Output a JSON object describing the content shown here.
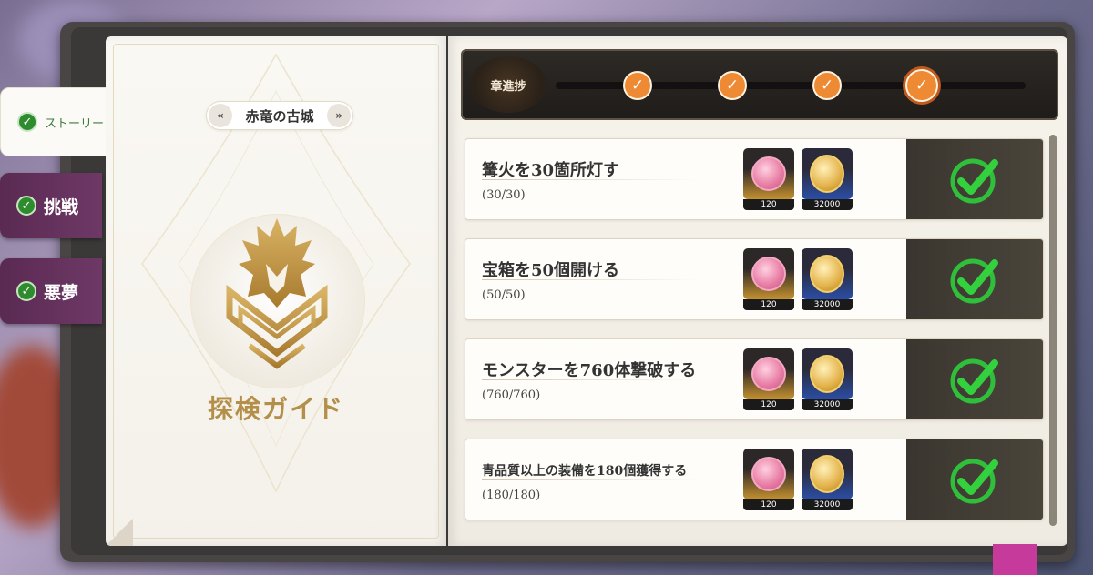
{
  "tabs": [
    {
      "label": "ストーリー"
    },
    {
      "label": "挑戦"
    },
    {
      "label": "悪夢"
    }
  ],
  "left_page": {
    "dungeon_name": "赤竜の古城",
    "prev_icon": "chevron-double-left-icon",
    "next_icon": "chevron-double-right-icon",
    "guide_title": "探検ガイド"
  },
  "progress": {
    "label": "章進捗",
    "milestones": [
      "check",
      "check",
      "check",
      "check"
    ]
  },
  "quests": [
    {
      "title": "篝火を30箇所灯す",
      "progress": "(30/30)",
      "rewards": [
        "120",
        "32000"
      ],
      "status": "completed"
    },
    {
      "title": "宝箱を50個開ける",
      "progress": "(50/50)",
      "rewards": [
        "120",
        "32000"
      ],
      "status": "completed"
    },
    {
      "title": "モンスターを760体撃破する",
      "progress": "(760/760)",
      "rewards": [
        "120",
        "32000"
      ],
      "status": "completed"
    },
    {
      "title": "青品質以上の装備を180個獲得する",
      "progress": "(180/180)",
      "rewards": [
        "120",
        "32000"
      ],
      "status": "completed"
    }
  ],
  "colors": {
    "accent_orange": "#ee8a34",
    "check_green": "#2fbf3a",
    "tab_purple": "#6e3866",
    "title_gold": "#b48f4a"
  }
}
